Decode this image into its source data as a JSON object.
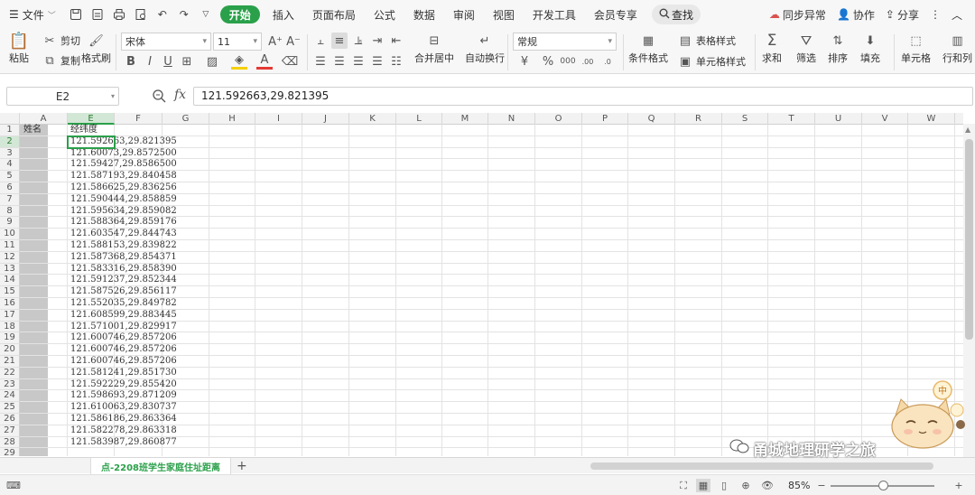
{
  "menubar": {
    "file_label": "文件",
    "tabs": [
      "开始",
      "插入",
      "页面布局",
      "公式",
      "数据",
      "审阅",
      "视图",
      "开发工具",
      "会员专享"
    ],
    "search_label": "查找",
    "right": {
      "sync": "同步异常",
      "collab": "协作",
      "share": "分享"
    }
  },
  "ribbon": {
    "paste": "粘贴",
    "cut": "剪切",
    "copy": "复制",
    "format_painter": "格式刷",
    "font_name": "宋体",
    "font_size": "11",
    "merge_center": "合并居中",
    "wrap_text": "自动换行",
    "number_format": "常规",
    "conditional_format": "条件格式",
    "table_style": "表格样式",
    "cell_style": "单元格样式",
    "sum": "求和",
    "filter": "筛选",
    "sort": "排序",
    "fill": "填充",
    "cell": "单元格",
    "row_col": "行和列"
  },
  "formula_bar": {
    "name_box": "E2",
    "fx_label": "fx",
    "content": "121.592663,29.821395"
  },
  "columns": [
    "A",
    "E",
    "F",
    "G",
    "H",
    "I",
    "J",
    "K",
    "L",
    "M",
    "N",
    "O",
    "P",
    "Q",
    "R",
    "S",
    "T",
    "U",
    "V",
    "W"
  ],
  "rows": {
    "headers": {
      "A": "姓名",
      "E": "经纬度"
    },
    "numbers": [
      "1",
      "2",
      "3",
      "4",
      "5",
      "6",
      "7",
      "8",
      "9",
      "10",
      "11",
      "12",
      "13",
      "14",
      "15",
      "16",
      "17",
      "18",
      "19",
      "20",
      "21",
      "22",
      "23",
      "24",
      "25",
      "26",
      "27",
      "28",
      "29"
    ],
    "coords": [
      "121.592663,29.821395",
      "121.60073,29.8572500",
      "121.59427,29.8586500",
      "121.587193,29.840458",
      "121.586625,29.836256",
      "121.590444,29.858859",
      "121.595634,29.859082",
      "121.588364,29.859176",
      "121.603547,29.844743",
      "121.588153,29.839822",
      "121.587368,29.854371",
      "121.583316,29.858390",
      "121.591237,29.852344",
      "121.587526,29.856117",
      "121.552035,29.849782",
      "121.608599,29.883445",
      "121.571001,29.829917",
      "121.600746,29.857206",
      "121.600746,29.857206",
      "121.600746,29.857206",
      "121.581241,29.851730",
      "121.592229,29.855420",
      "121.598693,29.871209",
      "121.610063,29.830737",
      "121.586186,29.863364",
      "121.582278,29.863318",
      "121.583987,29.860877"
    ]
  },
  "sheet_tab": "点-2208班学生家庭住址距离",
  "status": {
    "zoom": "85%"
  },
  "watermark": {
    "text": "甬城地理研学之旅"
  },
  "colors": {
    "accent": "#2aa04a",
    "selected_header": "#d3e7d6"
  }
}
